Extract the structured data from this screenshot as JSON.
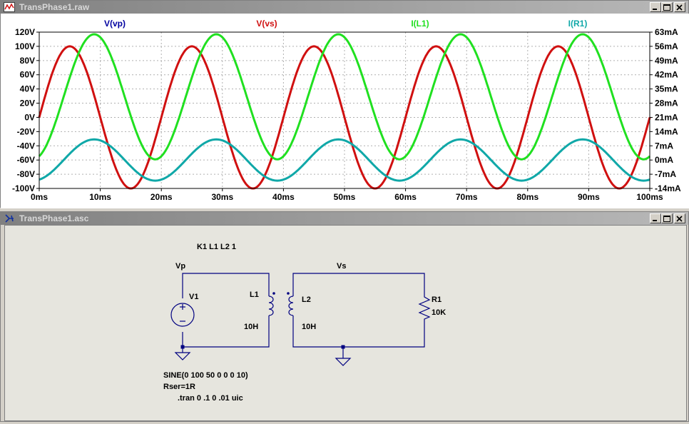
{
  "plot_window": {
    "title": "TransPhase1.raw"
  },
  "schematic_window": {
    "title": "TransPhase1.asc"
  },
  "chart_data": {
    "type": "line",
    "x_ticks": [
      "0ms",
      "10ms",
      "20ms",
      "30ms",
      "40ms",
      "50ms",
      "60ms",
      "70ms",
      "80ms",
      "90ms",
      "100ms"
    ],
    "y_left_ticks": [
      "120V",
      "100V",
      "80V",
      "60V",
      "40V",
      "20V",
      "0V",
      "-20V",
      "-40V",
      "-60V",
      "-80V",
      "-100V"
    ],
    "y_right_ticks": [
      "63mA",
      "56mA",
      "49mA",
      "42mA",
      "35mA",
      "28mA",
      "21mA",
      "14mA",
      "7mA",
      "0mA",
      "-7mA",
      "-14mA"
    ],
    "xlim": [
      0,
      100
    ],
    "ylim_left": [
      -100,
      120
    ],
    "ylim_right": [
      -14,
      63
    ],
    "grid": true,
    "series": [
      {
        "name": "V(vp)",
        "color": "#0000a0",
        "axis": "left",
        "amplitude": 100,
        "freq_hz": 50,
        "phase_deg": 0,
        "offset": 0,
        "visible_trace": false
      },
      {
        "name": "V(vs)",
        "color": "#d01010",
        "axis": "left",
        "amplitude": 100,
        "freq_hz": 50,
        "phase_deg": 0,
        "offset": 0
      },
      {
        "name": "I(L1)",
        "color": "#20e020",
        "axis": "left",
        "amplitude": 88,
        "freq_hz": 50,
        "phase_deg": -72,
        "offset": 29
      },
      {
        "name": "I(R1)",
        "color": "#10a8a8",
        "axis": "left",
        "amplitude": 29,
        "freq_hz": 50,
        "phase_deg": -72,
        "offset": -60
      }
    ]
  },
  "schematic": {
    "directive_coupling": "K1 L1 L2  1",
    "net_vp": "Vp",
    "net_vs": "Vs",
    "v1_name": "V1",
    "l1_name": "L1",
    "l1_value": "10H",
    "l2_name": "L2",
    "l2_value": "10H",
    "r1_name": "R1",
    "r1_value": "10K",
    "source_spec": "SINE(0 100 50 0 0 0 10)",
    "source_rser": "Rser=1R",
    "tran_directive": ".tran 0 .1 0 .01 uic"
  },
  "colors": {
    "wire": "#000080",
    "component": "#000080",
    "plot_bg": "#ffffff",
    "schematic_bg": "#e6e5de"
  }
}
